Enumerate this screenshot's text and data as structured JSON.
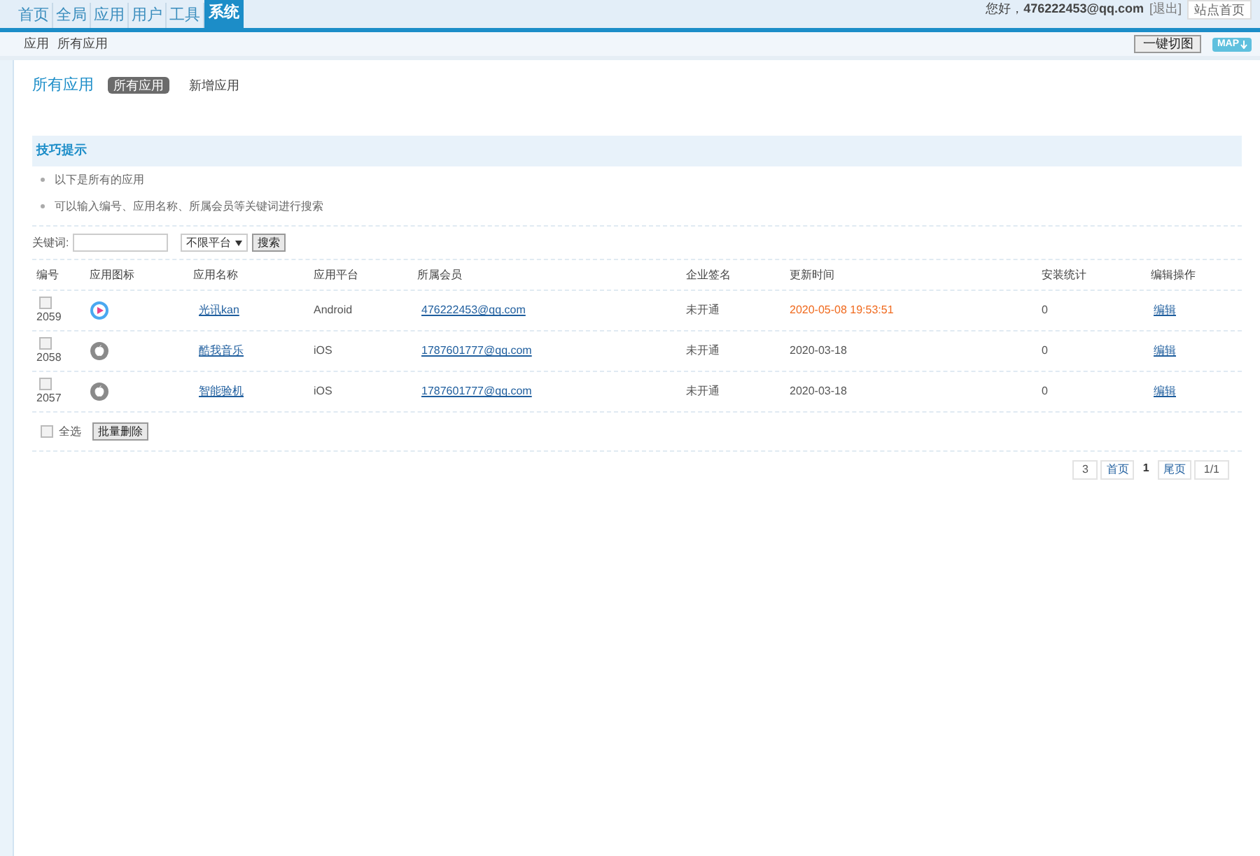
{
  "nav_tabs": [
    {
      "label": "首页",
      "selected": false
    },
    {
      "label": "全局",
      "selected": false
    },
    {
      "label": "应用",
      "selected": false
    },
    {
      "label": "用户",
      "selected": false
    },
    {
      "label": "工具",
      "selected": false
    },
    {
      "label": "系统",
      "selected": true
    }
  ],
  "user_bar": {
    "greeting": "您好，",
    "user": "476222453@qq.com",
    "logout": "[退出]",
    "home_button": "站点首页"
  },
  "breadcrumb": [
    "应用",
    "所有应用"
  ],
  "toolbar": {
    "switch_button": "一键切图",
    "map_button": "MAP"
  },
  "page_title": "所有应用",
  "sub_tabs": [
    {
      "label": "所有应用",
      "selected": true
    },
    {
      "label": "新增应用",
      "selected": false
    }
  ],
  "tips": {
    "title": "技巧提示",
    "items": [
      "以下是所有的应用",
      "可以输入编号、应用名称、所属会员等关键词进行搜索"
    ]
  },
  "search": {
    "label": "关键词:",
    "platform": "不限平台",
    "button": "搜索"
  },
  "table": {
    "columns": [
      "编号",
      "应用图标",
      "应用名称",
      "应用平台",
      "所属会员",
      "企业签名",
      "更新时间",
      "安装统计",
      "编辑操作"
    ],
    "rows": [
      {
        "checked": false,
        "id": "2059",
        "kind": "play",
        "name": "光讯kan",
        "platform": "Android",
        "member": "476222453@qq.com",
        "signature": "未开通",
        "time": "2020-05-08 19:53:51",
        "recent": true,
        "installs": "0",
        "action": "编辑"
      },
      {
        "checked": false,
        "id": "2058",
        "kind": "apple",
        "name": "酷我音乐",
        "platform": "iOS",
        "member": "1787601777@qq.com",
        "signature": "未开通",
        "time": "2020-03-18",
        "recent": false,
        "installs": "0",
        "action": "编辑"
      },
      {
        "checked": false,
        "id": "2057",
        "kind": "apple",
        "name": "智能验机",
        "platform": "iOS",
        "member": "1787601777@qq.com",
        "signature": "未开通",
        "time": "2020-03-18",
        "recent": false,
        "installs": "0",
        "action": "编辑"
      }
    ]
  },
  "bulk": {
    "select_all": "全选",
    "select_all_checked": false,
    "delete_button": "批量删除"
  },
  "pagination": {
    "total": "3",
    "first": "首页",
    "current": "1",
    "last": "尾页",
    "pages": "1/1"
  }
}
